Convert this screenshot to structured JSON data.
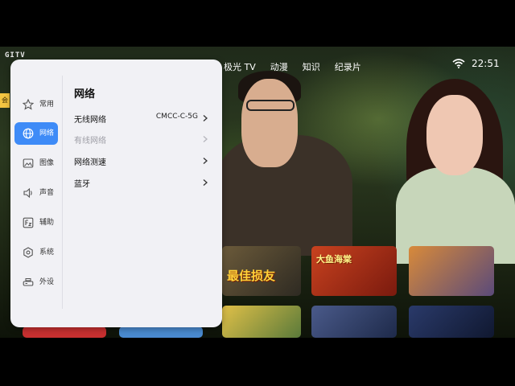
{
  "brand": {
    "logo_text": "GITV"
  },
  "top_nav": {
    "tabs": [
      "极光 TV",
      "动漫",
      "知识",
      "纪录片"
    ],
    "time": "22:51",
    "status_icons": [
      "wifi-icon"
    ]
  },
  "background": {
    "posters": [
      {
        "title": "最佳损友"
      },
      {
        "title": "大鱼海棠"
      },
      {
        "title": ""
      },
      {
        "title": ""
      },
      {
        "title": ""
      },
      {
        "title": ""
      },
      {
        "title": ""
      },
      {
        "title": ""
      }
    ],
    "edge_tag": "会"
  },
  "settings": {
    "sidebar": [
      {
        "label": "常用",
        "icon": "star-icon",
        "active": false
      },
      {
        "label": "网络",
        "icon": "globe-icon",
        "active": true
      },
      {
        "label": "图像",
        "icon": "image-icon",
        "active": false
      },
      {
        "label": "声音",
        "icon": "speaker-icon",
        "active": false
      },
      {
        "label": "辅助",
        "icon": "accessibility-icon",
        "active": false
      },
      {
        "label": "系统",
        "icon": "system-hexagon-icon",
        "active": false
      },
      {
        "label": "外设",
        "icon": "peripheral-icon",
        "active": false
      }
    ],
    "title": "网络",
    "rows": [
      {
        "label": "无线网络",
        "value": "CMCC-C-5G",
        "disabled": false
      },
      {
        "label": "有线网络",
        "value": "",
        "disabled": true
      },
      {
        "label": "网络测速",
        "value": "",
        "disabled": false
      },
      {
        "label": "蓝牙",
        "value": "",
        "disabled": false
      }
    ],
    "accent_color": "#3e8bf7"
  }
}
